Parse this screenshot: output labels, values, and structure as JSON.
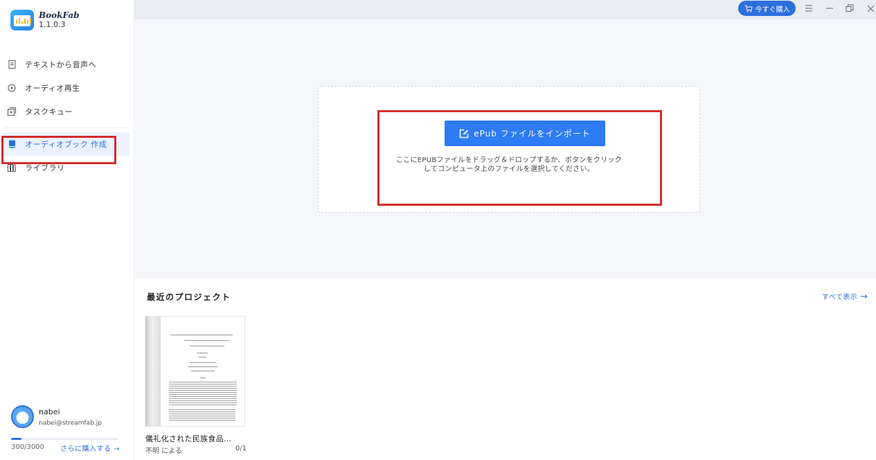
{
  "app": {
    "name": "BookFab",
    "version": "1.1.0.3"
  },
  "sidebar": {
    "items": [
      {
        "label": "テキストから音声へ",
        "icon": "document-icon"
      },
      {
        "label": "オーディオ再生",
        "icon": "play-circle-icon"
      },
      {
        "label": "タスクキュー",
        "icon": "task-queue-icon"
      },
      {
        "label": "オーディオブック 作成",
        "icon": "book-icon",
        "active": true
      },
      {
        "label": "ライブラリ",
        "icon": "library-icon"
      }
    ]
  },
  "user": {
    "name": "nabei",
    "email": "nabei@streamfab.jp",
    "quota_text": "300/3000",
    "quota_fraction": 0.1,
    "buy_more": "さらに購入する →"
  },
  "topbar": {
    "buy_now": "今すぐ購入"
  },
  "import": {
    "button": "ePub ファイルをインポート",
    "hint_line1": "ここにEPUBファイルをドラッグ＆ドロップするか、ボタンをクリック",
    "hint_line2": "してコンピュータ上のファイルを選択してください。"
  },
  "recent": {
    "title": "最近のプロジェクト",
    "view_all": "すべて表示",
    "projects": [
      {
        "name": "儀礼化された民族食品…",
        "author": "不明 による",
        "progress": "0/1"
      }
    ]
  },
  "colors": {
    "accent": "#2e6fde",
    "highlight": "#d42b2b",
    "primary_button": "#2e7bf6"
  }
}
